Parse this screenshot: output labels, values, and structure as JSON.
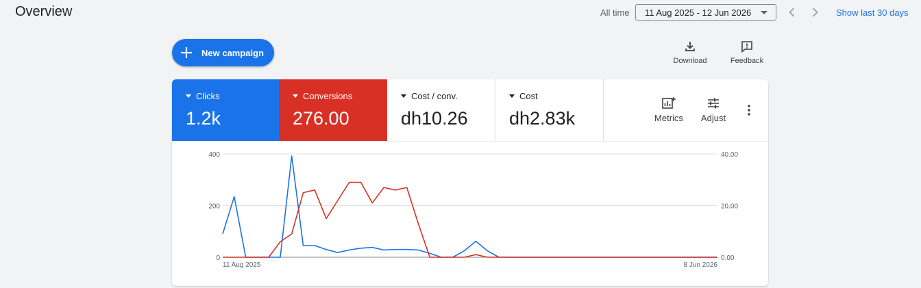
{
  "header": {
    "title": "Overview",
    "date_label": "All time",
    "date_range": "11 Aug 2025 - 12 Jun 2026",
    "show_last": "Show last 30 days"
  },
  "toolbar": {
    "new_campaign": "New campaign",
    "download": "Download",
    "feedback": "Feedback"
  },
  "metrics": [
    {
      "label": "Clicks",
      "value": "1.2k",
      "color": "#1a73e8"
    },
    {
      "label": "Conversions",
      "value": "276.00",
      "color": "#d93025"
    },
    {
      "label": "Cost / conv.",
      "value": "dh10.26"
    },
    {
      "label": "Cost",
      "value": "dh2.83k"
    }
  ],
  "card_actions": {
    "metrics": "Metrics",
    "adjust": "Adjust"
  },
  "icons": [
    "chevron-left-icon",
    "chevron-right-icon",
    "plus-icon",
    "download-icon",
    "feedback-icon",
    "metrics-icon",
    "adjust-icon",
    "more-vert-icon"
  ],
  "chart_data": {
    "type": "line",
    "x_tick_labels": [
      "11 Aug 2025",
      "8 Jun 2026"
    ],
    "y_left": {
      "ticks": [
        "0",
        "200",
        "400"
      ],
      "range": [
        0,
        400
      ]
    },
    "y_right": {
      "ticks": [
        "0.00",
        "20.00",
        "40.00"
      ],
      "range": [
        0,
        40
      ]
    },
    "grid": true,
    "series": [
      {
        "name": "Clicks",
        "axis": "left",
        "color": "#1a73e8",
        "values": [
          90,
          235,
          0,
          0,
          0,
          0,
          392,
          45,
          45,
          30,
          18,
          28,
          35,
          38,
          28,
          30,
          30,
          28,
          15,
          0,
          0,
          25,
          62,
          25,
          0,
          0,
          0,
          0,
          0,
          0,
          0,
          0,
          0,
          0,
          0,
          0,
          0,
          0,
          0,
          0,
          0,
          0,
          0,
          0
        ]
      },
      {
        "name": "Conversions",
        "axis": "right",
        "color": "#d93025",
        "values": [
          0,
          0,
          0,
          0,
          0,
          6,
          9,
          25,
          26,
          15,
          22,
          29,
          29,
          21,
          27,
          26,
          27,
          13,
          0,
          0,
          0,
          0,
          1,
          0,
          0,
          0,
          0,
          0,
          0,
          0,
          0,
          0,
          0,
          0,
          0,
          0,
          0,
          0,
          0,
          0,
          0,
          0,
          0,
          0
        ]
      }
    ]
  }
}
